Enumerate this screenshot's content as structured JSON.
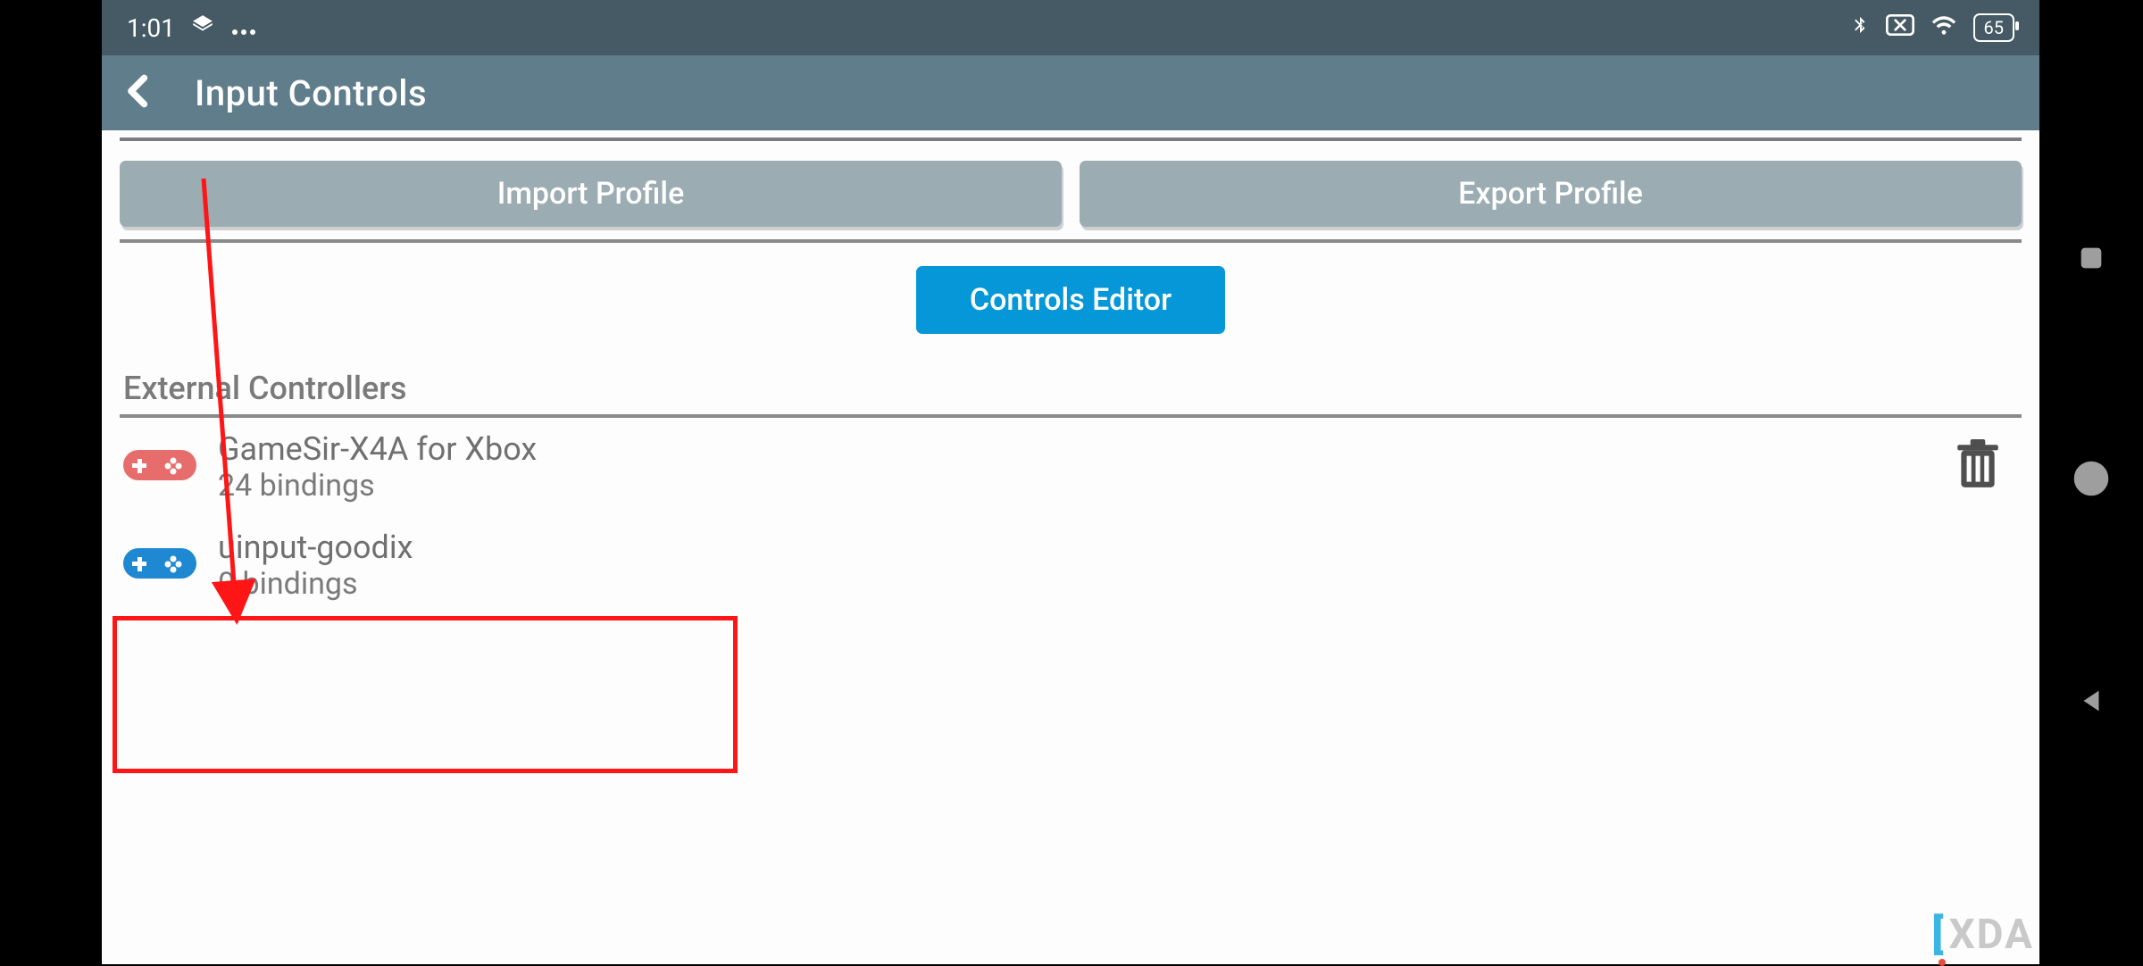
{
  "status": {
    "time": "1:01",
    "battery": "65"
  },
  "titlebar": {
    "title": "Input Controls"
  },
  "buttons": {
    "import": "Import Profile",
    "export": "Export Profile",
    "editor": "Controls Editor"
  },
  "section": {
    "external": "External Controllers"
  },
  "controllers": [
    {
      "name": "GameSir-X4A for Xbox",
      "bindings": "24 bindings",
      "color": "#e76d6c",
      "deletable": true
    },
    {
      "name": "uinput-goodix",
      "bindings": "0 bindings",
      "color": "#1e88d2",
      "deletable": false
    }
  ],
  "watermark": "XDA"
}
